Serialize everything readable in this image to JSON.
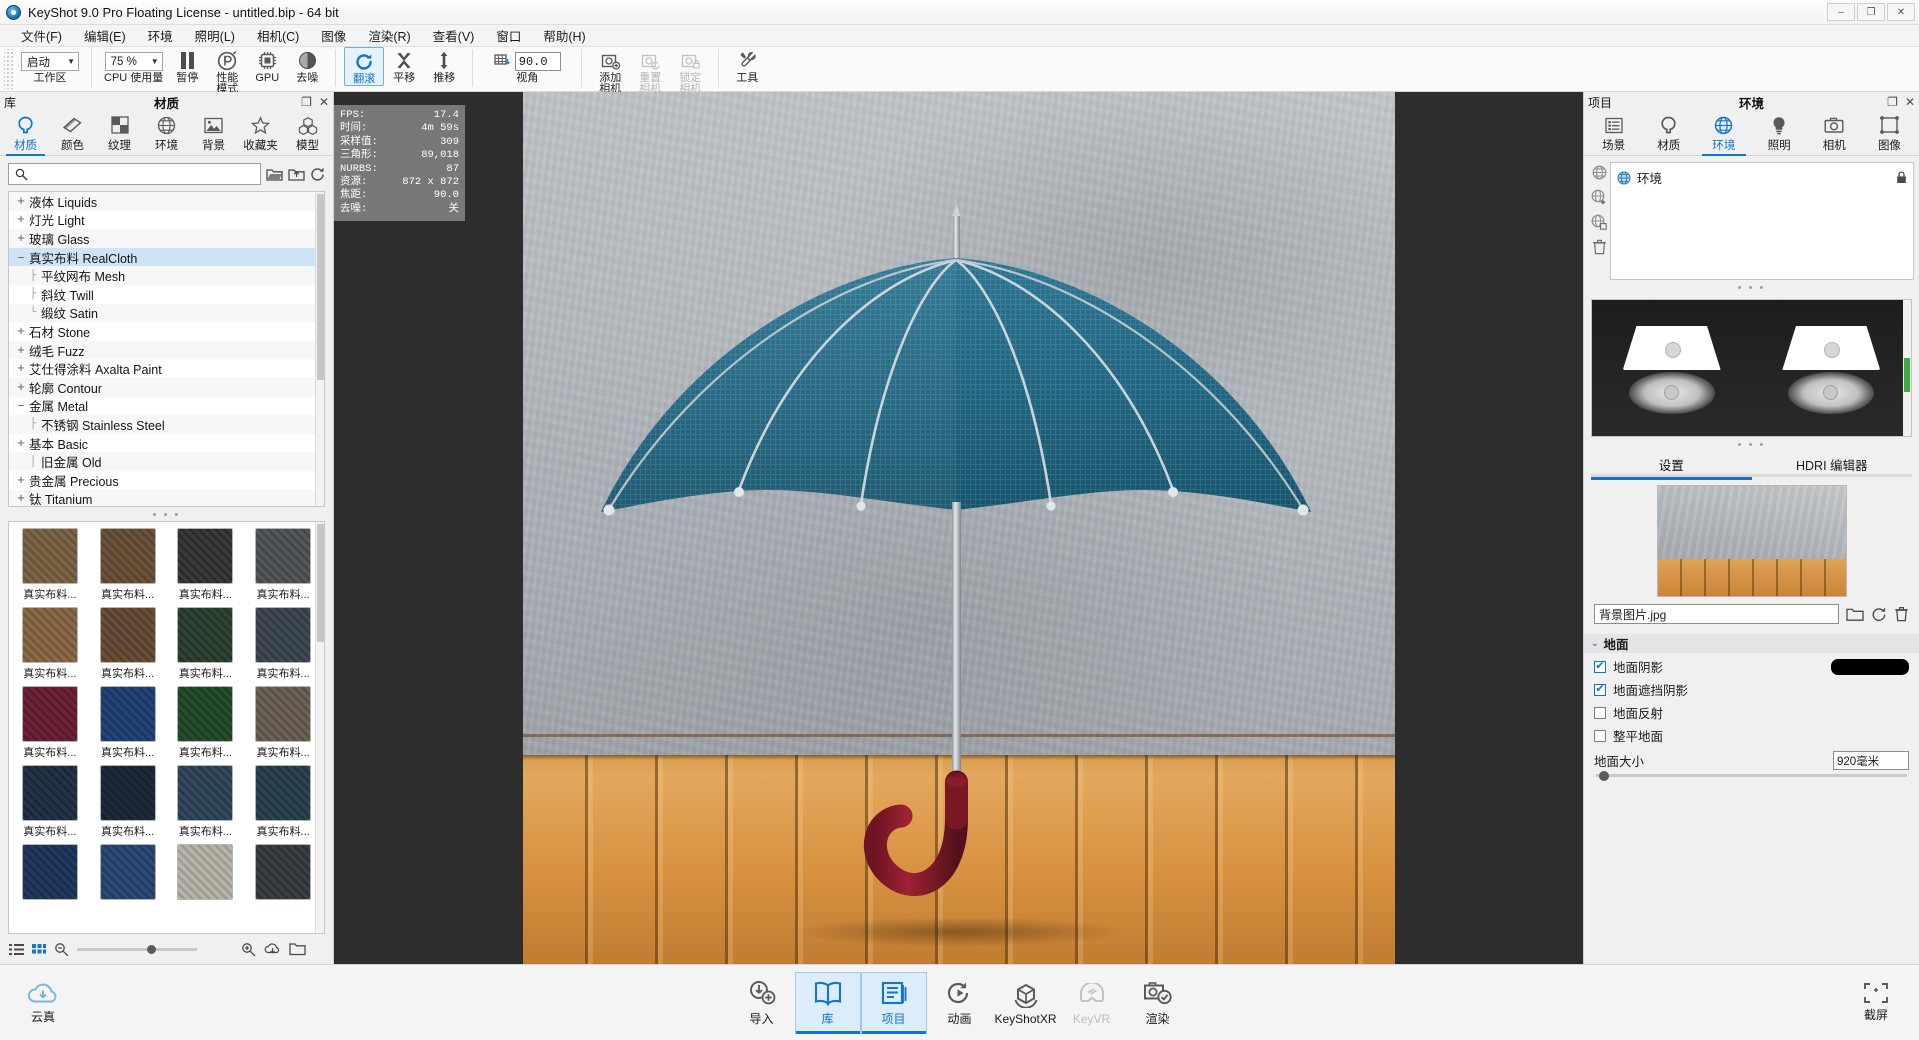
{
  "window": {
    "title": "KeyShot 9.0 Pro Floating License  - untitled.bip  - 64 bit",
    "icon": "keyshot-logo-icon",
    "minimize": "–",
    "maximize": "❐",
    "close": "✕"
  },
  "menubar": {
    "items": [
      {
        "label": "文件(F)",
        "name": "menu-file"
      },
      {
        "label": "编辑(E)",
        "name": "menu-edit"
      },
      {
        "label": "环境",
        "name": "menu-environment"
      },
      {
        "label": "照明(L)",
        "name": "menu-lighting"
      },
      {
        "label": "相机(C)",
        "name": "menu-camera"
      },
      {
        "label": "图像",
        "name": "menu-image"
      },
      {
        "label": "渲染(R)",
        "name": "menu-render"
      },
      {
        "label": "查看(V)",
        "name": "menu-view"
      },
      {
        "label": "窗口",
        "name": "menu-window"
      },
      {
        "label": "帮助(H)",
        "name": "menu-help"
      }
    ]
  },
  "toolbar": {
    "workspace": {
      "value": "启动",
      "label": "工作区"
    },
    "cpu_usage": {
      "value": "75 %",
      "label": "CPU 使用量"
    },
    "pause": {
      "label": "暂停",
      "icon": "pause-icon"
    },
    "performance_mode": {
      "label": "性能\n模式",
      "icon": "performance-icon"
    },
    "gpu": {
      "label": "GPU",
      "icon": "gpu-chip-icon"
    },
    "denoise": {
      "label": "去噪",
      "icon": "denoise-sphere-icon"
    },
    "rotate": {
      "label": "翻滚",
      "icon": "rotate-icon",
      "active": true
    },
    "pan": {
      "label": "平移",
      "icon": "pan-icon"
    },
    "dolly": {
      "label": "推移",
      "icon": "dolly-icon"
    },
    "fov": {
      "value": "90.0",
      "label": "视角",
      "icon": "perspective-grid-icon"
    },
    "add_camera": {
      "label": "添加\n相机",
      "icon": "camera-add-icon"
    },
    "reset_camera": {
      "label": "重置\n相机",
      "icon": "camera-reset-icon",
      "disabled": true
    },
    "lock_camera": {
      "label": "锁定\n相机",
      "icon": "camera-lock-icon",
      "disabled": true
    },
    "tools": {
      "label": "工具",
      "icon": "tools-icon"
    }
  },
  "library": {
    "header_left": "库",
    "header_title": "材质",
    "header_controls": [
      "undock-icon",
      "close-icon"
    ],
    "tabs": [
      {
        "label": "材质",
        "icon": "material-drop-icon",
        "selected": true
      },
      {
        "label": "颜色",
        "icon": "color-chip-icon",
        "selected": false
      },
      {
        "label": "纹理",
        "icon": "texture-checker-icon",
        "selected": false
      },
      {
        "label": "环境",
        "icon": "globe-icon",
        "selected": false
      },
      {
        "label": "背景",
        "icon": "picture-icon",
        "selected": false
      },
      {
        "label": "收藏夹",
        "icon": "star-icon",
        "selected": false
      },
      {
        "label": "模型",
        "icon": "model-cubes-icon",
        "selected": false
      }
    ],
    "search": {
      "value": "",
      "placeholder": "",
      "icon": "search-icon"
    },
    "search_actions": [
      "folder-import-icon",
      "folder-open-icon",
      "refresh-icon"
    ],
    "tree": [
      {
        "label": "液体 Liquids",
        "toggle": "+",
        "child": false,
        "selected": false
      },
      {
        "label": "灯光 Light",
        "toggle": "+",
        "child": false,
        "selected": false
      },
      {
        "label": "玻璃 Glass",
        "toggle": "+",
        "child": false,
        "selected": false
      },
      {
        "label": "真实布料 RealCloth",
        "toggle": "–",
        "child": false,
        "selected": true
      },
      {
        "label": "平纹网布 Mesh",
        "toggle": "├",
        "child": true,
        "selected": false
      },
      {
        "label": "斜纹 Twill",
        "toggle": "├",
        "child": true,
        "selected": false
      },
      {
        "label": "缎纹 Satin",
        "toggle": "└",
        "child": true,
        "selected": false
      },
      {
        "label": "石材 Stone",
        "toggle": "+",
        "child": false,
        "selected": false
      },
      {
        "label": "绒毛 Fuzz",
        "toggle": "+",
        "child": false,
        "selected": false
      },
      {
        "label": "艾仕得涂料 Axalta Paint",
        "toggle": "+",
        "child": false,
        "selected": false
      },
      {
        "label": "轮廓 Contour",
        "toggle": "+",
        "child": false,
        "selected": false
      },
      {
        "label": "金属 Metal",
        "toggle": "–",
        "child": false,
        "selected": false
      },
      {
        "label": "不锈钢 Stainless Steel",
        "toggle": "├",
        "child": true,
        "selected": false
      },
      {
        "label": "基本 Basic",
        "toggle": "+",
        "child": false,
        "selected": false
      },
      {
        "label": "旧金属 Old",
        "toggle": "│",
        "child": true,
        "selected": false
      },
      {
        "label": "贵金属 Precious",
        "toggle": "+",
        "child": false,
        "selected": false
      },
      {
        "label": "钛 Titanium",
        "toggle": "+",
        "child": false,
        "selected": false
      }
    ],
    "grip": "• • •",
    "swatches": [
      {
        "label": "真实布料...",
        "color": "#7d6547"
      },
      {
        "label": "真实布料...",
        "color": "#6d533a"
      },
      {
        "label": "真实布料...",
        "color": "#3a3a38"
      },
      {
        "label": "真实布料...",
        "color": "#55585b"
      },
      {
        "label": "真实布料...",
        "color": "#8a6a4a"
      },
      {
        "label": "真实布料...",
        "color": "#6b4f38"
      },
      {
        "label": "真实布料...",
        "color": "#2f4434"
      },
      {
        "label": "真实布料...",
        "color": "#3e4a56"
      },
      {
        "label": "真实布料...",
        "color": "#6d2236"
      },
      {
        "label": "真实布料...",
        "color": "#23457a"
      },
      {
        "label": "真实布料...",
        "color": "#25502c"
      },
      {
        "label": "真实布料...",
        "color": "#6d6455"
      },
      {
        "label": "真实布料...",
        "color": "#23344a"
      },
      {
        "label": "真实布料...",
        "color": "#1f2b3d"
      },
      {
        "label": "真实布料...",
        "color": "#314a5e"
      },
      {
        "label": "真实布料...",
        "color": "#2b4450"
      },
      {
        "label": "",
        "color": "#223a63"
      },
      {
        "label": "",
        "color": "#2c4b7c"
      },
      {
        "label": "",
        "color": "#b9b5ab"
      },
      {
        "label": "",
        "color": "#3a3f44"
      }
    ],
    "footer_icons": [
      "list-view-icon",
      "grid-view-icon",
      "zoom-out-icon",
      "zoom-in-icon",
      "cloud-download-icon",
      "folder-icon"
    ]
  },
  "hud": {
    "rows": [
      {
        "key": "FPS:",
        "value": "17.4"
      },
      {
        "key": "时间:",
        "value": "4m 59s"
      },
      {
        "key": "采样值:",
        "value": "309"
      },
      {
        "key": "三角形:",
        "value": "89,018"
      },
      {
        "key": "NURBS:",
        "value": "87"
      },
      {
        "key": "资源:",
        "value": "872 x 872"
      },
      {
        "key": "焦距:",
        "value": "90.0"
      },
      {
        "key": "去噪:",
        "value": "关"
      }
    ]
  },
  "viewport": {
    "scene_description": "umbrella-render",
    "resolution": "872 x 872"
  },
  "project": {
    "header_left": "项目",
    "header_title": "环境",
    "header_controls": [
      "undock-icon",
      "close-icon"
    ],
    "tabs": [
      {
        "label": "场景",
        "icon": "scene-list-icon",
        "selected": false
      },
      {
        "label": "材质",
        "icon": "material-drop-icon",
        "selected": false
      },
      {
        "label": "环境",
        "icon": "globe-icon",
        "selected": true
      },
      {
        "label": "照明",
        "icon": "light-bulb-icon",
        "selected": false
      },
      {
        "label": "相机",
        "icon": "camera-icon",
        "selected": false
      },
      {
        "label": "图像",
        "icon": "image-frame-icon",
        "selected": false
      }
    ],
    "side_icons": [
      "env-globe-icon",
      "env-add-icon",
      "env-copy-icon",
      "env-delete-icon"
    ],
    "env_list": [
      {
        "label": "环境",
        "icon": "globe-icon",
        "lock": "lock-icon"
      }
    ],
    "grip": "• • •",
    "sub_tabs": [
      {
        "label": "设置",
        "selected": true
      },
      {
        "label": "HDRI 编辑器",
        "selected": false
      }
    ],
    "background_file": {
      "value": "背景图片.jpg",
      "actions": [
        "folder-open-icon",
        "refresh-icon",
        "trash-icon"
      ]
    },
    "ground_section": {
      "title": "地面",
      "caret": "⌄",
      "options": [
        {
          "label": "地面阴影",
          "checked": true,
          "swatch": "#000000"
        },
        {
          "label": "地面遮挡阴影",
          "checked": true
        },
        {
          "label": "地面反射",
          "checked": false
        },
        {
          "label": "整平地面",
          "checked": false
        }
      ],
      "ground_size": {
        "label": "地面大小",
        "value": "920毫米"
      }
    }
  },
  "dock": {
    "left": {
      "label": "云真",
      "icon": "cloud-icon"
    },
    "items": [
      {
        "label": "导入",
        "icon": "import-icon",
        "selected": false,
        "dim": false
      },
      {
        "label": "库",
        "icon": "book-icon",
        "selected": true,
        "dim": false
      },
      {
        "label": "项目",
        "icon": "project-list-icon",
        "selected": true,
        "dim": false
      },
      {
        "label": "动画",
        "icon": "animation-play-icon",
        "selected": false,
        "dim": false
      },
      {
        "label": "KeyShotXR",
        "icon": "xr-cube-icon",
        "selected": false,
        "dim": false
      },
      {
        "label": "KeyVR",
        "icon": "vr-headset-icon",
        "selected": false,
        "dim": true
      },
      {
        "label": "渲染",
        "icon": "render-camera-icon",
        "selected": false,
        "dim": false
      }
    ],
    "right": {
      "label": "截屏",
      "icon": "fullscreen-icon"
    }
  },
  "colors": {
    "accent": "#1274d4",
    "selection": "#cde4f7",
    "panel_bg": "#f0f0f0",
    "umbrella": "#1f6480"
  }
}
